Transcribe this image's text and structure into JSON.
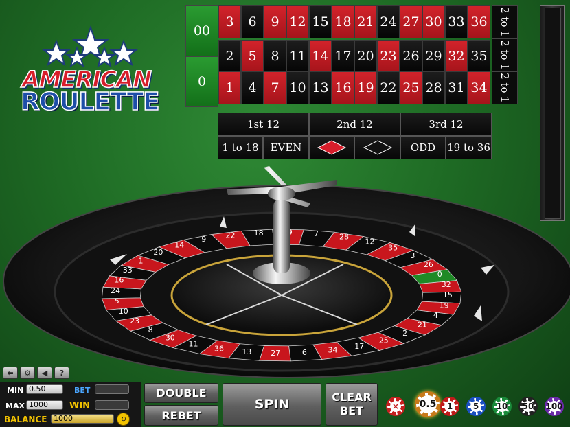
{
  "logo": {
    "line1": "AMERICAN",
    "line2": "ROULETTE"
  },
  "table": {
    "zeros": [
      "00",
      "0"
    ],
    "rows": [
      [
        {
          "n": "3",
          "c": "red"
        },
        {
          "n": "6",
          "c": "black"
        },
        {
          "n": "9",
          "c": "red"
        },
        {
          "n": "12",
          "c": "red"
        },
        {
          "n": "15",
          "c": "black"
        },
        {
          "n": "18",
          "c": "red"
        },
        {
          "n": "21",
          "c": "red"
        },
        {
          "n": "24",
          "c": "black"
        },
        {
          "n": "27",
          "c": "red"
        },
        {
          "n": "30",
          "c": "red"
        },
        {
          "n": "33",
          "c": "black"
        },
        {
          "n": "36",
          "c": "red"
        }
      ],
      [
        {
          "n": "2",
          "c": "black"
        },
        {
          "n": "5",
          "c": "red"
        },
        {
          "n": "8",
          "c": "black"
        },
        {
          "n": "11",
          "c": "black"
        },
        {
          "n": "14",
          "c": "red"
        },
        {
          "n": "17",
          "c": "black"
        },
        {
          "n": "20",
          "c": "black"
        },
        {
          "n": "23",
          "c": "red"
        },
        {
          "n": "26",
          "c": "black"
        },
        {
          "n": "29",
          "c": "black"
        },
        {
          "n": "32",
          "c": "red"
        },
        {
          "n": "35",
          "c": "black"
        }
      ],
      [
        {
          "n": "1",
          "c": "red"
        },
        {
          "n": "4",
          "c": "black"
        },
        {
          "n": "7",
          "c": "red"
        },
        {
          "n": "10",
          "c": "black"
        },
        {
          "n": "13",
          "c": "black"
        },
        {
          "n": "16",
          "c": "red"
        },
        {
          "n": "19",
          "c": "red"
        },
        {
          "n": "22",
          "c": "black"
        },
        {
          "n": "25",
          "c": "red"
        },
        {
          "n": "28",
          "c": "black"
        },
        {
          "n": "31",
          "c": "black"
        },
        {
          "n": "34",
          "c": "red"
        }
      ]
    ],
    "column_bets": [
      "2 to 1",
      "2 to 1",
      "2 to 1"
    ],
    "dozens": [
      "1st 12",
      "2nd 12",
      "3rd 12"
    ],
    "outside": [
      "1 to 18",
      "EVEN",
      "ODD",
      "19 to 36"
    ],
    "colors": {
      "red": "#c8161d",
      "black": "#0a0a0a",
      "green": "#1f8a26"
    }
  },
  "wheel": {
    "visible_numbers": [
      "22",
      "18",
      "29",
      "7",
      "28",
      "12",
      "35",
      "3",
      "26",
      "0",
      "32",
      "15",
      "19",
      "4",
      "21",
      "2",
      "25",
      "17",
      "34",
      "6",
      "27",
      "13",
      "36",
      "11",
      "30",
      "8",
      "23",
      "10",
      "5",
      "24",
      "16",
      "33",
      "1",
      "20",
      "14",
      "9"
    ],
    "green_pocket": "0"
  },
  "controls": {
    "icons": [
      "back-icon",
      "settings-icon",
      "sound-icon",
      "help-icon"
    ],
    "icon_glyphs": [
      "⬅",
      "⚙",
      "◀",
      "?"
    ],
    "min_label": "MIN",
    "min_value": "0.50",
    "max_label": "MAX",
    "max_value": "1000",
    "bet_label": "BET",
    "bet_value": "",
    "win_label": "WIN",
    "win_value": "",
    "balance_label": "BALANCE",
    "balance_value": "1000"
  },
  "buttons": {
    "double": "DOUBLE",
    "rebet": "REBET",
    "spin": "SPIN",
    "clear_line1": "CLEAR",
    "clear_line2": "BET"
  },
  "chips": [
    {
      "label": "×",
      "color": "#c62020",
      "name": "clear-chip"
    },
    {
      "label": "0.5",
      "color": "#c87a1a",
      "name": "chip-0-5",
      "selected": true
    },
    {
      "label": "1",
      "color": "#c01a1a",
      "name": "chip-1"
    },
    {
      "label": "5",
      "color": "#1a4fc0",
      "name": "chip-5"
    },
    {
      "label": "10",
      "color": "#1a8a3a",
      "name": "chip-10"
    },
    {
      "label": "50",
      "color": "#222222",
      "name": "chip-50"
    },
    {
      "label": "100",
      "color": "#6a2aa8",
      "name": "chip-100"
    }
  ]
}
